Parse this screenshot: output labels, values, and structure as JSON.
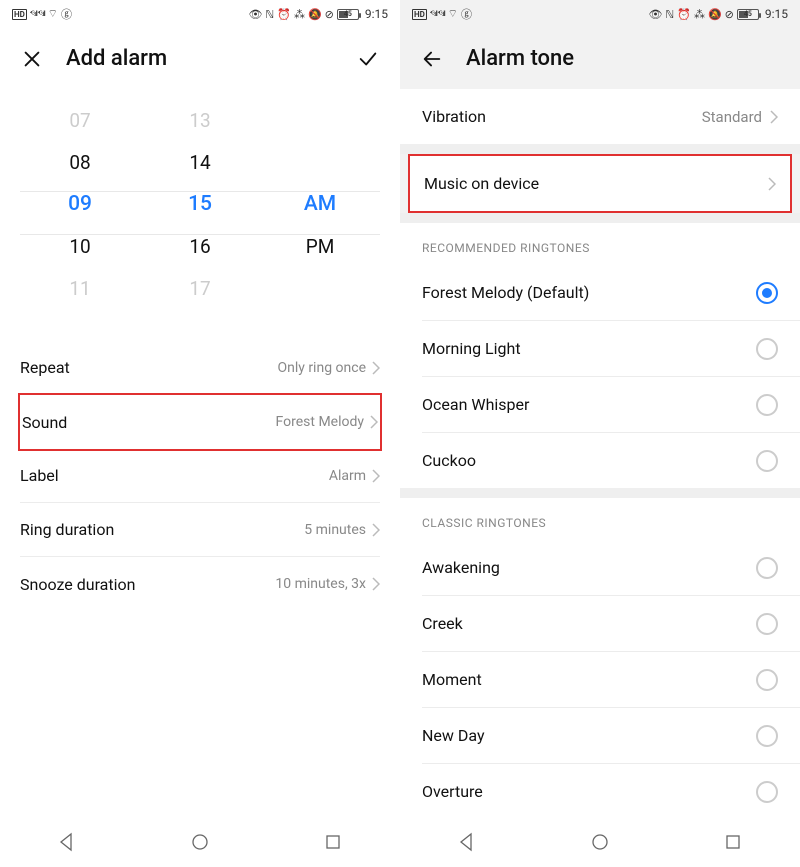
{
  "statusbar": {
    "hd": "HD",
    "signal_label": "4G",
    "wifi": "⌔",
    "swirl": "ⓖ",
    "battery_pct": "45",
    "time": "9:15"
  },
  "left": {
    "title": "Add alarm",
    "picker": {
      "hours": [
        "07",
        "08",
        "09",
        "10",
        "11"
      ],
      "minutes": [
        "13",
        "14",
        "15",
        "16",
        "17"
      ],
      "am": "AM",
      "pm": "PM"
    },
    "rows": {
      "repeat": {
        "label": "Repeat",
        "value": "Only ring once"
      },
      "sound": {
        "label": "Sound",
        "value": "Forest Melody"
      },
      "label_row": {
        "label": "Label",
        "value": "Alarm"
      },
      "ring": {
        "label": "Ring duration",
        "value": "5 minutes"
      },
      "snooze": {
        "label": "Snooze duration",
        "value": "10 minutes, 3x"
      }
    }
  },
  "right": {
    "title": "Alarm tone",
    "vibration": {
      "label": "Vibration",
      "value": "Standard"
    },
    "music": {
      "label": "Music on device"
    },
    "sections": {
      "recommended": {
        "header": "RECOMMENDED RINGTONES",
        "items": [
          "Forest Melody (Default)",
          "Morning Light",
          "Ocean Whisper",
          "Cuckoo"
        ],
        "selected_index": 0
      },
      "classic": {
        "header": "CLASSIC RINGTONES",
        "items": [
          "Awakening",
          "Creek",
          "Moment",
          "New Day",
          "Overture"
        ]
      }
    }
  }
}
